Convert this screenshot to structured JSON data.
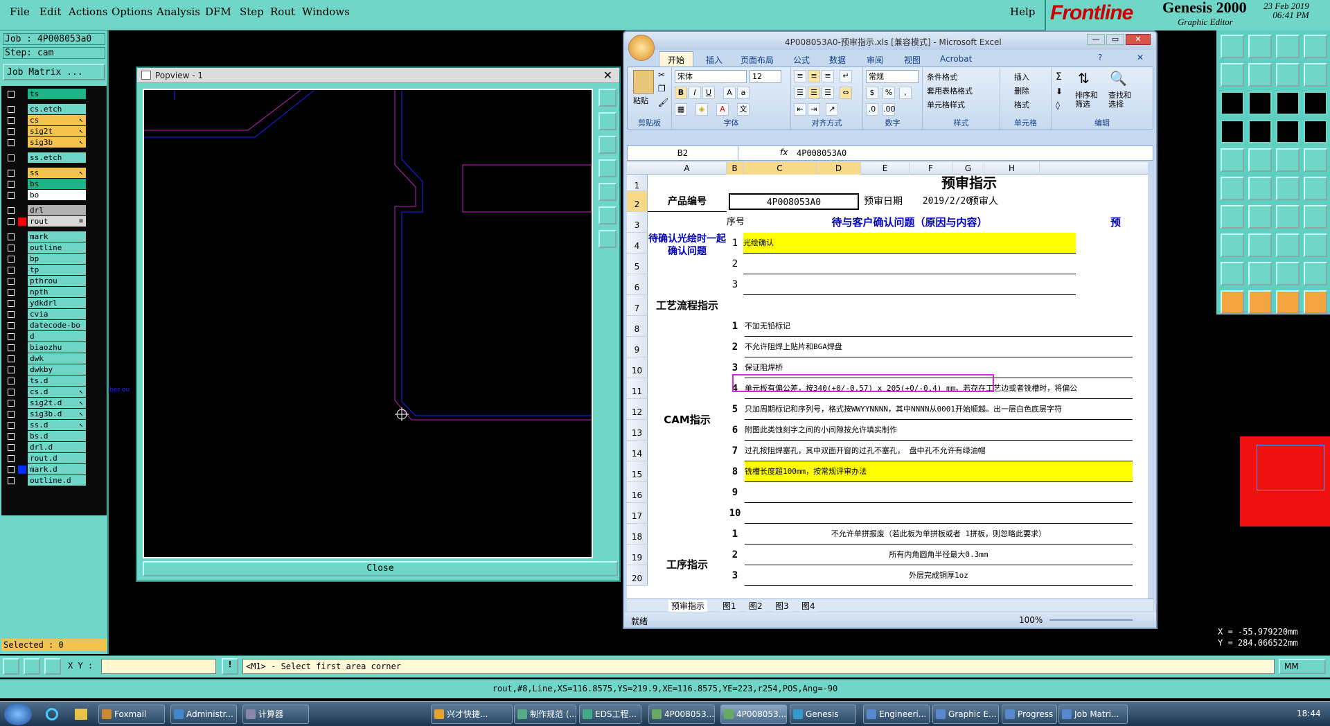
{
  "menubar": {
    "items": [
      "File",
      "Edit",
      "Actions",
      "Options",
      "Analysis",
      "DFM",
      "Step",
      "Rout",
      "Windows"
    ],
    "help": "Help"
  },
  "logo": {
    "brand": "Frontline",
    "product": "Genesis 2000",
    "subtitle": "Graphic Editor",
    "date": "23 Feb 2019",
    "time": "06:41 PM"
  },
  "job": {
    "job_label": "Job : 4P008053a0",
    "step_label": "Step: cam",
    "matrix_button": "Job Matrix ..."
  },
  "layers": [
    {
      "name": "ts",
      "color": "#1db587",
      "tag": ""
    },
    {
      "name": "cs.etch",
      "color": "#6fd6c8",
      "tag": ""
    },
    {
      "name": "cs",
      "color": "#f3c34e",
      "tag": "↖"
    },
    {
      "name": "sig2t",
      "color": "#f3c34e",
      "tag": "↖"
    },
    {
      "name": "sig3b",
      "color": "#f3c34e",
      "tag": "↖"
    },
    {
      "name": "ss.etch",
      "color": "#6fd6c8",
      "tag": ""
    },
    {
      "name": "ss",
      "color": "#f3c34e",
      "tag": "↖"
    },
    {
      "name": "bs",
      "color": "#1db587",
      "tag": ""
    },
    {
      "name": "bo",
      "color": "#ffffff",
      "tag": ""
    },
    {
      "name": "drl",
      "color": "#b0b0b0",
      "tag": ""
    },
    {
      "name": "rout",
      "color": "#d8d8d8",
      "tag": "≡"
    },
    {
      "name": "mark",
      "color": "#6fd6c8",
      "tag": ""
    },
    {
      "name": "outline",
      "color": "#6fd6c8",
      "tag": ""
    },
    {
      "name": "bp",
      "color": "#6fd6c8",
      "tag": ""
    },
    {
      "name": "tp",
      "color": "#6fd6c8",
      "tag": ""
    },
    {
      "name": "pthrou",
      "color": "#6fd6c8",
      "tag": ""
    },
    {
      "name": "npth",
      "color": "#6fd6c8",
      "tag": ""
    },
    {
      "name": "ydkdrl",
      "color": "#6fd6c8",
      "tag": ""
    },
    {
      "name": "cvia",
      "color": "#6fd6c8",
      "tag": ""
    },
    {
      "name": "datecode-bo",
      "color": "#6fd6c8",
      "tag": ""
    },
    {
      "name": "d",
      "color": "#6fd6c8",
      "tag": ""
    },
    {
      "name": "biaozhu",
      "color": "#6fd6c8",
      "tag": ""
    },
    {
      "name": "dwk",
      "color": "#6fd6c8",
      "tag": ""
    },
    {
      "name": "dwkby",
      "color": "#6fd6c8",
      "tag": ""
    },
    {
      "name": "ts.d",
      "color": "#6fd6c8",
      "tag": ""
    },
    {
      "name": "cs.d",
      "color": "#6fd6c8",
      "tag": "↖"
    },
    {
      "name": "sig2t.d",
      "color": "#6fd6c8",
      "tag": "↖"
    },
    {
      "name": "sig3b.d",
      "color": "#6fd6c8",
      "tag": "↖"
    },
    {
      "name": "ss.d",
      "color": "#6fd6c8",
      "tag": "↖"
    },
    {
      "name": "bs.d",
      "color": "#6fd6c8",
      "tag": ""
    },
    {
      "name": "drl.d",
      "color": "#6fd6c8",
      "tag": ""
    },
    {
      "name": "rout.d",
      "color": "#6fd6c8",
      "tag": ""
    },
    {
      "name": "mark.d",
      "color": "#6fd6c8",
      "tag": ""
    },
    {
      "name": "outline.d",
      "color": "#6fd6c8",
      "tag": ""
    }
  ],
  "selected_label": "Selected : 0",
  "popview": {
    "title": "Popview - 1",
    "close": "Close",
    "side_text": "ber ou"
  },
  "excel": {
    "title": "4P008053A0-预审指示.xls  [兼容模式]  - Microsoft Excel",
    "tabs": [
      "开始",
      "插入",
      "页面布局",
      "公式",
      "数据",
      "审阅",
      "视图",
      "Acrobat"
    ],
    "ribbon": {
      "paste": "粘贴",
      "clipboard": "剪贴板",
      "font_name": "宋体",
      "font_size": "12",
      "font_group": "字体",
      "align_group": "对齐方式",
      "number_format": "常规",
      "number_group": "数字",
      "cond_format": "条件格式",
      "table_format": "套用表格格式",
      "cell_style": "单元格样式",
      "style_group": "样式",
      "insert": "插入",
      "delete": "删除",
      "format": "格式",
      "cells_group": "单元格",
      "sort": "排序和筛选",
      "find": "查找和选择",
      "edit_group": "编辑"
    },
    "namebox": "B2",
    "formula": "4P008053A0",
    "columns": [
      "A",
      "B",
      "C",
      "D",
      "E",
      "F",
      "G",
      "H"
    ],
    "rows": [
      "1",
      "2",
      "3",
      "4",
      "5",
      "6",
      "7",
      "8",
      "9",
      "10",
      "11",
      "12",
      "13",
      "14",
      "15",
      "16",
      "17",
      "18",
      "19",
      "20"
    ],
    "sheet": {
      "title": "预审指示",
      "prod_no_label": "产品编号",
      "prod_no": "4P008053A0",
      "date_label": "预审日期",
      "date": "2019/2/20",
      "reviewer_label": "预审人",
      "seq_label": "序号",
      "pending_header": "待与客户确认问题（原因与内容）",
      "pending_right": "预",
      "pending_group": "待确认光绘时一起确认问题",
      "pending_items": [
        {
          "n": "1",
          "text": "光绘确认"
        },
        {
          "n": "2",
          "text": ""
        },
        {
          "n": "3",
          "text": ""
        }
      ],
      "process_label": "工艺流程指示",
      "cam_label": "CAM指示",
      "cam_items": [
        {
          "n": "1",
          "text": "不加无铅标记"
        },
        {
          "n": "2",
          "text": "不允许阻焊上贴片和BGA焊盘"
        },
        {
          "n": "3",
          "text": "保证阻焊桥"
        },
        {
          "n": "4",
          "text": "单元板有偏公差，按340(+0/-0.57) x 205(+0/-0.4) mm。若存在工艺边或者铣槽时，将偏公"
        },
        {
          "n": "5",
          "text": "只加周期标记和序列号，格式按WWYYNNNN，其中NNNN从0001开始顺越。出一层白色底层字符"
        },
        {
          "n": "6",
          "text": "附图此类蚀刻字之间的小间隙按允许填实制作"
        },
        {
          "n": "7",
          "text": "过孔按阻焊塞孔，其中双面开窗的过孔不塞孔， 盘中孔不允许有绿油帽"
        },
        {
          "n": "8",
          "text": "铣槽长度超100mm，按常规评审办法"
        },
        {
          "n": "9",
          "text": ""
        },
        {
          "n": "10",
          "text": ""
        }
      ],
      "process_group": "工序指示",
      "process_items": [
        {
          "n": "1",
          "text": "不允许单拼报废（若此板为单拼板或者 1拼板，则忽略此要求）"
        },
        {
          "n": "2",
          "text": "所有内角圆角半径最大0.3mm"
        },
        {
          "n": "3",
          "text": "外层完成铜厚1oz"
        }
      ]
    },
    "sheet_tabs": [
      "预审指示",
      "图1",
      "图2",
      "图3",
      "图4"
    ],
    "status": "就绪",
    "zoom": "100%"
  },
  "coords": {
    "x": "X = -55.979220mm",
    "y": "Y = 284.066522mm"
  },
  "cmdbar": {
    "xy_label": "X Y :",
    "prompt": "<M1> - Select first area corner",
    "units": "MM"
  },
  "statusline": "rout,#8,Line,XS=116.8575,YS=219.9,XE=116.8575,YE=223,r254,POS,Ang=-90",
  "taskbar": {
    "items": [
      "Foxmail",
      "Administr...",
      "计算器",
      "兴才快捷...",
      "制作规范 (...",
      "EDS工程...",
      "4P008053...",
      "4P008053...",
      "Genesis",
      "Engineeri...",
      "Graphic E...",
      "Progress",
      "Job Matri..."
    ],
    "clock": "18:44"
  }
}
